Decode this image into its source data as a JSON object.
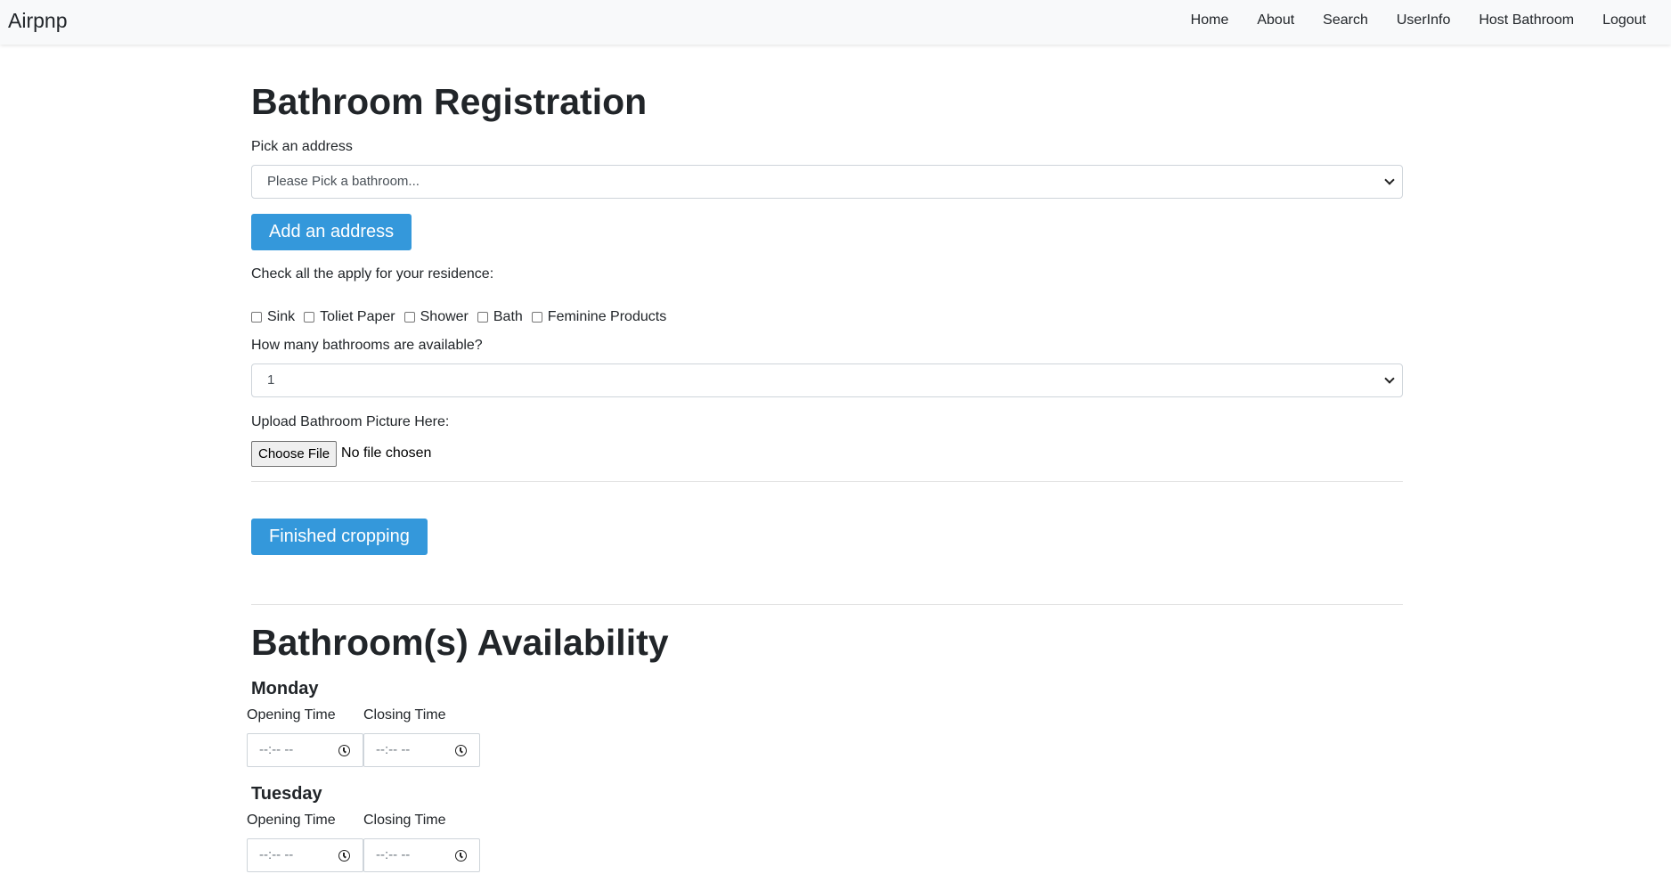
{
  "nav": {
    "brand": "Airpnp",
    "links": [
      "Home",
      "About",
      "Search",
      "UserInfo",
      "Host Bathroom",
      "Logout"
    ]
  },
  "registration": {
    "title": "Bathroom Registration",
    "address_label": "Pick an address",
    "address_select_value": "Please Pick a bathroom...",
    "add_address_button": "Add an address",
    "amenities_label": "Check all the apply for your residence:",
    "amenities": [
      {
        "label": "Sink",
        "checked": false
      },
      {
        "label": "Toliet Paper",
        "checked": false
      },
      {
        "label": "Shower",
        "checked": false
      },
      {
        "label": "Bath",
        "checked": false
      },
      {
        "label": "Feminine Products",
        "checked": false
      }
    ],
    "count_label": "How many bathrooms are available?",
    "count_select_value": "1",
    "upload_label": "Upload Bathroom Picture Here:",
    "choose_file_button": "Choose File",
    "file_status": "No file chosen",
    "finished_button": "Finished cropping"
  },
  "availability": {
    "title": "Bathroom(s) Availability",
    "opening_label": "Opening Time",
    "closing_label": "Closing Time",
    "time_placeholder": "--:-- --",
    "days": [
      "Monday",
      "Tuesday"
    ]
  },
  "colors": {
    "primary_button": "#3498db",
    "navbar_bg": "#f8f9fa"
  }
}
